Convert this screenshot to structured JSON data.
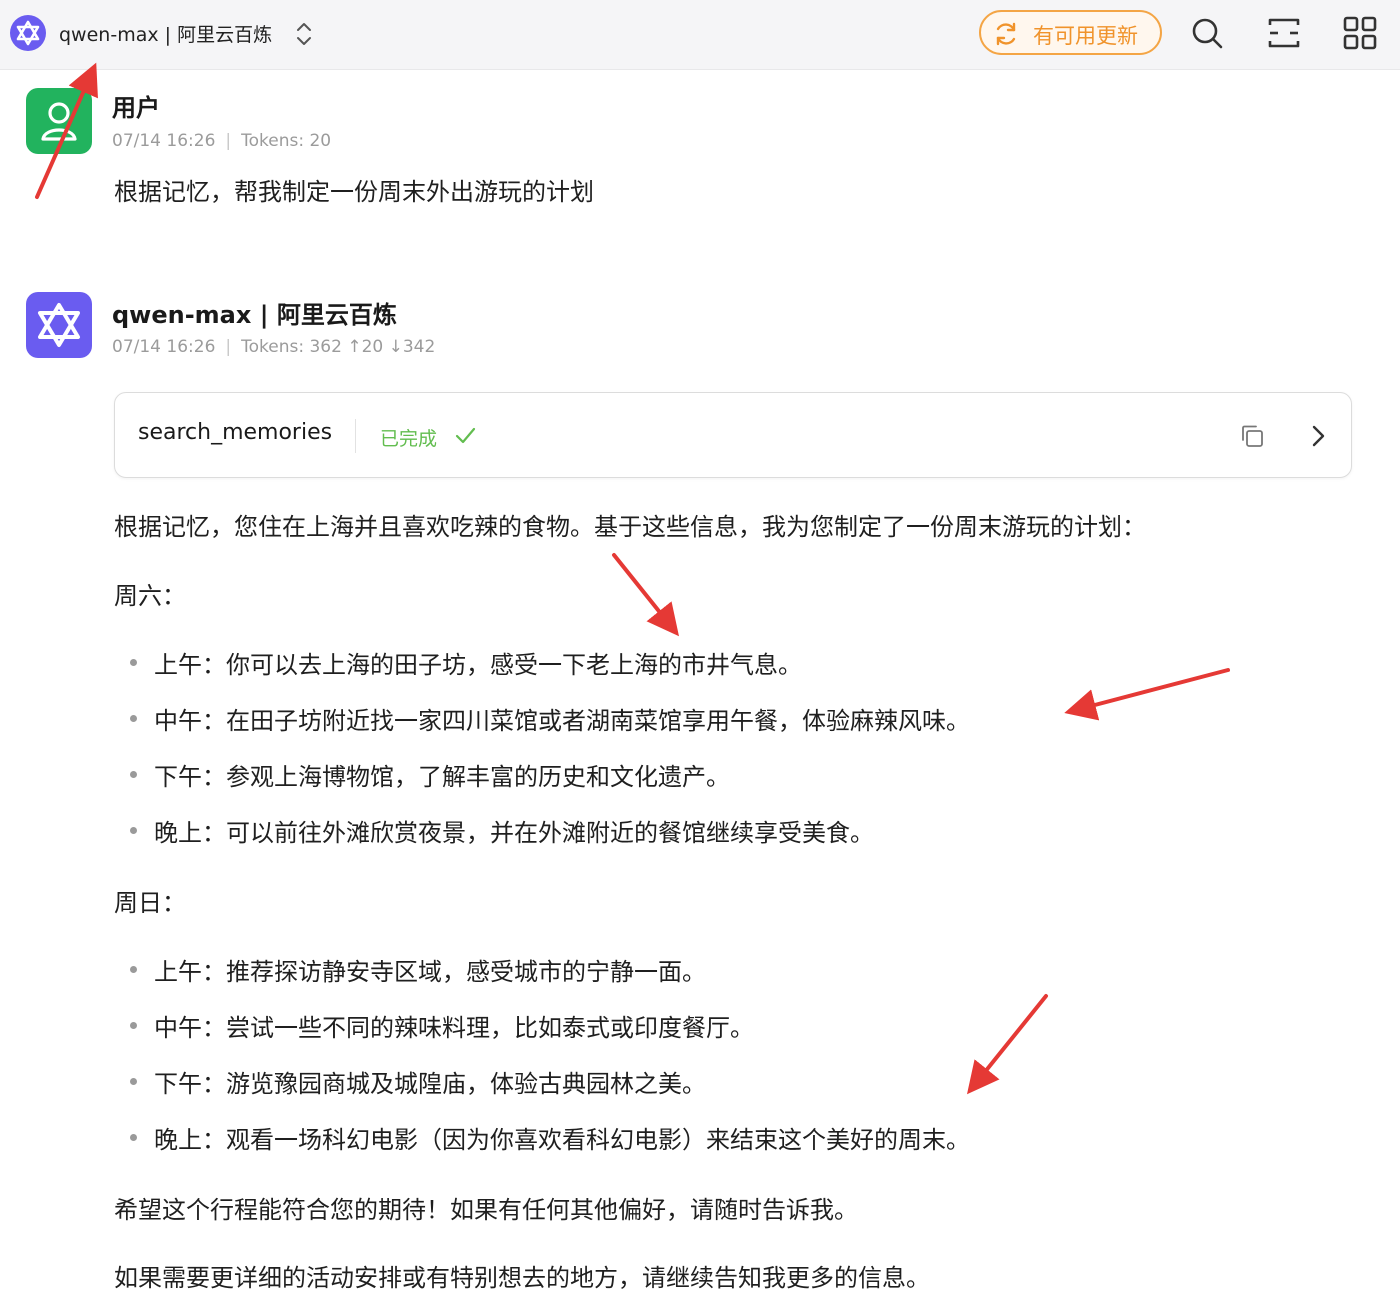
{
  "topbar": {
    "title": "qwen-max | 阿里云百炼",
    "update_label": "有可用更新",
    "icons": [
      "qwen-logo-icon",
      "switch-model-chevron-icon",
      "refresh-icon",
      "search-icon",
      "layout-icon",
      "grid-icon"
    ]
  },
  "colors": {
    "accent_purple": "#6a5cf0",
    "user_green": "#22b35e",
    "update_orange": "#f0932b",
    "status_green": "#62bd4f",
    "annotation_red": "#e53935"
  },
  "user_message": {
    "name": "用户",
    "time": "07/14 16:26",
    "tokens": "Tokens: 20",
    "text": "根据记忆，帮我制定一份周末外出游玩的计划"
  },
  "assistant_message": {
    "name": "qwen-max | 阿里云百炼",
    "time": "07/14 16:26",
    "tokens": "Tokens: 362 ↑20 ↓342",
    "tool_call": {
      "name": "search_memories",
      "status": "已完成"
    },
    "intro": "根据记忆，您住在上海并且喜欢吃辣的食物。基于这些信息，我为您制定了一份周末游玩的计划：",
    "saturday": {
      "heading": "周六：",
      "items": [
        "上午：你可以去上海的田子坊，感受一下老上海的市井气息。",
        "中午：在田子坊附近找一家四川菜馆或者湖南菜馆享用午餐，体验麻辣风味。",
        "下午：参观上海博物馆，了解丰富的历史和文化遗产。",
        "晚上：可以前往外滩欣赏夜景，并在外滩附近的餐馆继续享受美食。"
      ]
    },
    "sunday": {
      "heading": "周日：",
      "items": [
        "上午：推荐探访静安寺区域，感受城市的宁静一面。",
        "中午：尝试一些不同的辣味料理，比如泰式或印度餐厅。",
        "下午：游览豫园商城及城隍庙，体验古典园林之美。",
        "晚上：观看一场科幻电影（因为你喜欢看科幻电影）来结束这个美好的周末。"
      ]
    },
    "closing_1": "希望这个行程能符合您的期待！如果有任何其他偏好，请随时告诉我。",
    "closing_2": "如果需要更详细的活动安排或有特别想去的地方，请继续告知我更多的信息。"
  }
}
